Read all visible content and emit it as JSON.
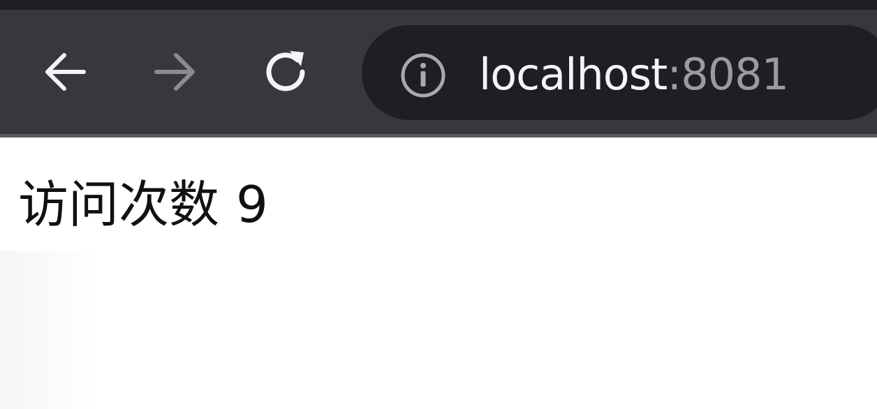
{
  "browser": {
    "url_host": "localhost",
    "url_port": ":8081",
    "icons": {
      "back": "arrow-left",
      "forward": "arrow-right",
      "reload": "reload",
      "site_info": "info-circle"
    },
    "colors": {
      "toolbar": "#38373e",
      "urlbar": "#1f1e23",
      "icon_active": "#f4f4f6",
      "icon_disabled": "#8c8b90"
    }
  },
  "page": {
    "label": "访问次数",
    "count": "9"
  }
}
